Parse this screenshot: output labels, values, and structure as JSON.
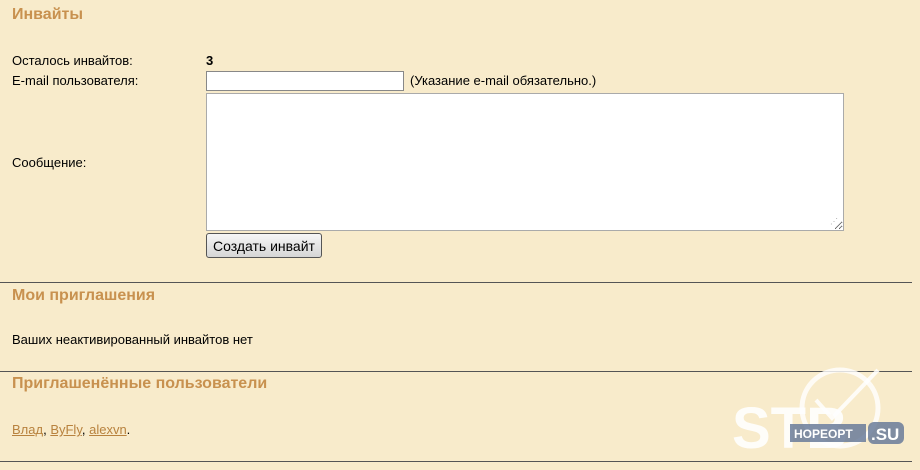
{
  "invites": {
    "title": "Инвайты",
    "remaining_label": "Осталось инвайтов:",
    "remaining_value": "3",
    "email_label": "E-mail пользователя:",
    "email_value": "",
    "email_note": "(Указание e-mail обязательно.)",
    "message_label": "Сообщение:",
    "message_value": "",
    "create_button": "Создать инвайт"
  },
  "my_invites": {
    "title": "Мои приглашения",
    "empty_text": "Ваших неактивированный инвайтов нет"
  },
  "invited_users": {
    "title": "Приглашенённые пользователи",
    "users": [
      "Влад",
      "ByFly",
      "alexvn"
    ],
    "separator": ", ",
    "end": "."
  },
  "watermark": {
    "logo_text": "STB",
    "sub_text": "HOPEOPT",
    "domain": ".SU"
  },
  "colors": {
    "background": "#f8ebcb",
    "heading": "#c8914f",
    "link": "#b8823e"
  }
}
